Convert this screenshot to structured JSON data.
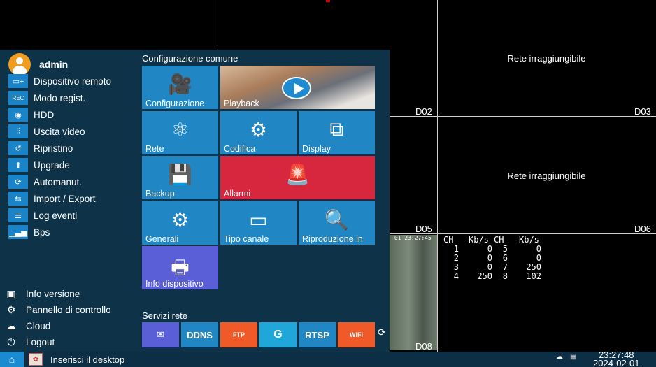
{
  "cameras": {
    "unreachable_msg": "Rete irraggiungibile",
    "labels": [
      "D02",
      "D03",
      "D05",
      "D06",
      "D08"
    ],
    "timestamp": "-01 23:27:45"
  },
  "bitrate": {
    "headers": [
      "CH",
      "Kb/s",
      "CH",
      "Kb/s"
    ],
    "rows": [
      [
        "1",
        "0",
        "5",
        "0"
      ],
      [
        "2",
        "0",
        "6",
        "0"
      ],
      [
        "3",
        "0",
        "7",
        "250"
      ],
      [
        "4",
        "250",
        "8",
        "102"
      ]
    ]
  },
  "menu": {
    "user": "admin",
    "side_items": [
      {
        "label": "Dispositivo remoto",
        "icon": "monitor-plus-icon"
      },
      {
        "label": "Modo regist.",
        "icon": "rec-icon"
      },
      {
        "label": "HDD",
        "icon": "hdd-icon"
      },
      {
        "label": "Uscita video",
        "icon": "sliders-icon"
      },
      {
        "label": "Ripristino",
        "icon": "restore-icon"
      },
      {
        "label": "Upgrade",
        "icon": "upgrade-icon"
      },
      {
        "label": "Automanut.",
        "icon": "auto-maintenance-icon"
      },
      {
        "label": "Import / Export",
        "icon": "import-export-icon"
      },
      {
        "label": "Log eventi",
        "icon": "log-icon"
      },
      {
        "label": "Bps",
        "icon": "bps-chart-icon"
      }
    ],
    "bottom_items": [
      {
        "label": "Info versione",
        "icon": "version-info-icon"
      },
      {
        "label": "Pannello di controllo",
        "icon": "gear-icon"
      },
      {
        "label": "Cloud",
        "icon": "cloud-icon"
      },
      {
        "label": "Logout",
        "icon": "power-icon"
      }
    ],
    "common_title": "Configurazione comune",
    "tiles": {
      "configurazione": "Configurazione",
      "playback": "Playback",
      "rete": "Rete",
      "codifica": "Codifica",
      "display": "Display",
      "backup": "Backup",
      "allarmi": "Allarmi",
      "generali": "Generali",
      "tipo_canale": "Tipo canale",
      "riproduzione": "Riproduzione in",
      "info_dispositivo": "Info dispositivo"
    },
    "net_title": "Servizi rete",
    "services": {
      "email": "",
      "ddns": "DDNS",
      "ftp": "FTP",
      "g": "G",
      "rtsp": "RTSP",
      "wifi": "WIFI"
    }
  },
  "taskbar": {
    "desktop_label": "Inserisci il desktop",
    "time": "23:27:48",
    "date": "2024-02-01"
  },
  "colors": {
    "menu_bg": "#0e3349",
    "tile_blue": "#2187c4",
    "alarm_red": "#d7273f",
    "info_purple": "#5a5fd8",
    "accent_orange": "#f09c1e"
  }
}
